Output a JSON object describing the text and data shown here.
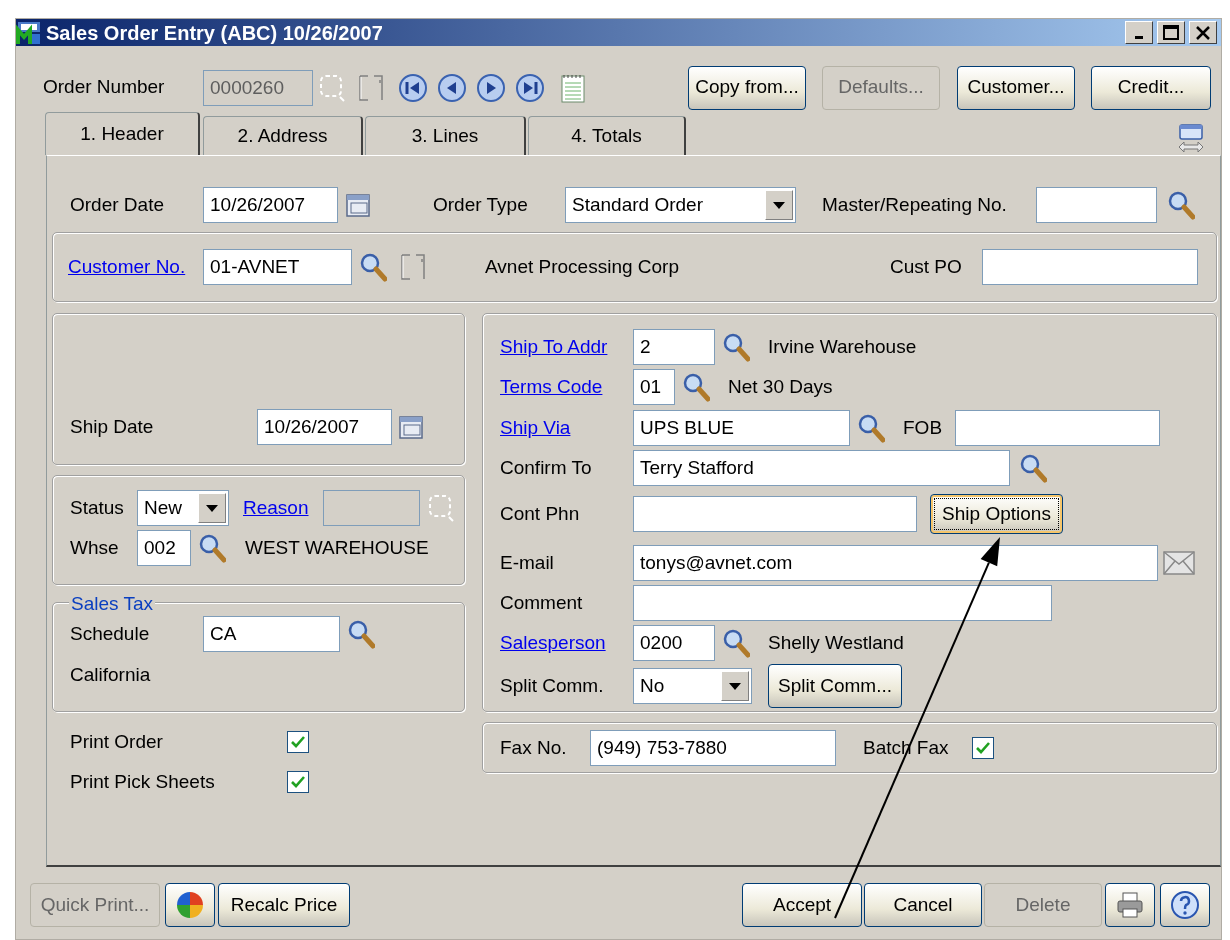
{
  "window": {
    "title": "Sales Order Entry (ABC) 10/26/2007"
  },
  "order_number": {
    "label": "Order Number",
    "value": "0000260",
    "disabled": true
  },
  "top_buttons": [
    {
      "label": "Copy from...",
      "disabled": false
    },
    {
      "label": "Defaults...",
      "disabled": true
    },
    {
      "label": "Customer...",
      "disabled": false
    },
    {
      "label": "Credit...",
      "disabled": false
    }
  ],
  "tabs": [
    {
      "label": "1. Header",
      "selected": true
    },
    {
      "label": "2. Address",
      "selected": false
    },
    {
      "label": "3. Lines",
      "selected": false
    },
    {
      "label": "4. Totals",
      "selected": false
    }
  ],
  "order_date": {
    "label": "Order Date",
    "value": "10/26/2007"
  },
  "order_type": {
    "label": "Order Type",
    "value": "Standard Order"
  },
  "master_repeating": {
    "label": "Master/Repeating No."
  },
  "customer": {
    "label": "Customer No.",
    "value": "01-AVNET",
    "name": "Avnet Processing Corp",
    "cust_po_label": "Cust PO"
  },
  "ship_date": {
    "label": "Ship Date",
    "value": "10/26/2007"
  },
  "status": {
    "label": "Status",
    "value": "New"
  },
  "reason": {
    "label": "Reason",
    "disabled": true
  },
  "warehouse": {
    "label": "Whse",
    "value": "002",
    "name": "WEST WAREHOUSE"
  },
  "sales_tax": {
    "title": "Sales Tax",
    "schedule_label": "Schedule",
    "schedule": "CA",
    "description": "California"
  },
  "print_options": [
    {
      "label": "Print Order",
      "checked": true
    },
    {
      "label": "Print Pick Sheets",
      "checked": true
    }
  ],
  "ship_to": {
    "label": "Ship To Addr",
    "value": "2",
    "name": "Irvine Warehouse"
  },
  "terms": {
    "label": "Terms Code",
    "value": "01",
    "name": "Net 30 Days"
  },
  "ship_via": {
    "label": "Ship Via",
    "value": "UPS BLUE",
    "fob_label": "FOB"
  },
  "confirm_to": {
    "label": "Confirm To",
    "value": "Terry Stafford"
  },
  "contact_phone": {
    "label": "Cont Phn",
    "button": "Ship Options",
    "button_focused": true
  },
  "email": {
    "label": "E-mail",
    "value": "tonys@avnet.com"
  },
  "comment": {
    "label": "Comment"
  },
  "salesperson": {
    "label": "Salesperson",
    "value": "0200",
    "name": "Shelly Westland"
  },
  "split_comm": {
    "label": "Split Comm.",
    "value": "No",
    "button": "Split Comm..."
  },
  "fax": {
    "label": "Fax No.",
    "value": "(949) 753-7880",
    "batch_label": "Batch Fax",
    "batch_checked": true
  },
  "bottom_left_buttons": [
    {
      "label": "Quick Print...",
      "disabled": true
    },
    {
      "label": "Recalc Price",
      "disabled": false
    }
  ],
  "bottom_right_buttons": [
    {
      "label": "Accept",
      "disabled": false
    },
    {
      "label": "Cancel",
      "disabled": false
    },
    {
      "label": "Delete",
      "disabled": true
    }
  ]
}
